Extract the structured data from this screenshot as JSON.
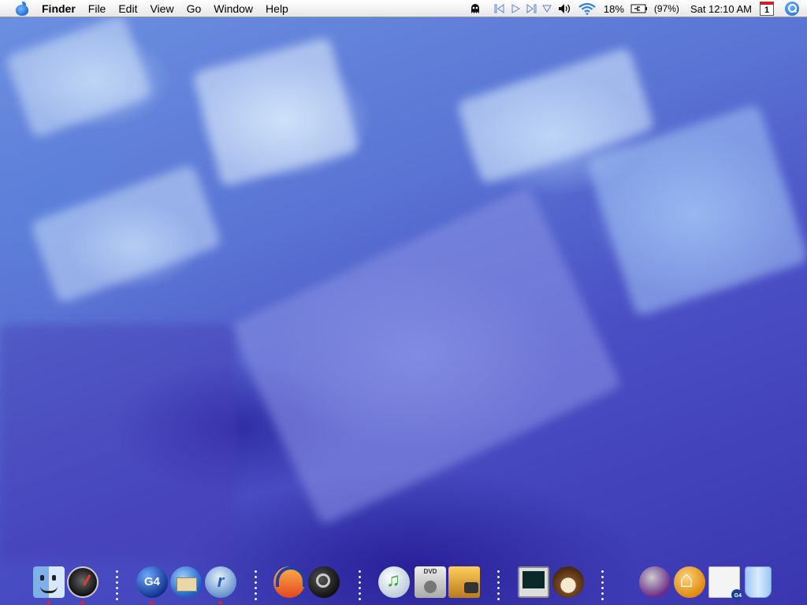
{
  "menubar": {
    "app_name": "Finder",
    "menus": [
      "File",
      "Edit",
      "View",
      "Go",
      "Window",
      "Help"
    ],
    "extras": {
      "ghost_icon": "ghost-icon",
      "media_controls": [
        "previous-track-icon",
        "play-icon",
        "next-track-icon",
        "dropdown-triangle-icon"
      ],
      "volume_icon": "speaker-icon",
      "wifi_icon": "wifi-icon",
      "cpu_percent": "18%",
      "battery_icon": "battery-icon",
      "battery_percent": "(97%)",
      "clock": "Sat 12:10 AM",
      "calendar_day": "1",
      "spotlight_icon": "spotlight-search-icon"
    }
  },
  "dock": {
    "apps": [
      {
        "name": "finder-icon",
        "running": true
      },
      {
        "name": "dashboard-icon",
        "running": true
      },
      {
        "name": "g4-app-icon",
        "label": "G4",
        "running": true
      },
      {
        "name": "thunderbird-icon",
        "running": false
      },
      {
        "name": "realplayer-icon",
        "label": "r",
        "running": true
      },
      {
        "name": "audacity-icon",
        "running": false
      },
      {
        "name": "spy-magnifier-icon",
        "running": false
      },
      {
        "name": "itunes-icon",
        "running": false
      },
      {
        "name": "dvd-player-icon",
        "label": "DVD",
        "running": false
      },
      {
        "name": "iphoto-icon",
        "running": false
      },
      {
        "name": "activity-monitor-icon",
        "running": false
      },
      {
        "name": "coconut-battery-icon",
        "running": false
      },
      {
        "name": "vlc-icon",
        "running": false
      },
      {
        "name": "home-folder-icon",
        "running": false
      },
      {
        "name": "document-g4-icon",
        "label": "G4",
        "running": false
      },
      {
        "name": "trash-icon",
        "running": false
      }
    ]
  },
  "colors": {
    "menubar_bg": "#f2f2f2",
    "accent_blue": "#1a63d1",
    "running_indicator": "#dd2233",
    "wallpaper_base": "#4a4fc4"
  }
}
